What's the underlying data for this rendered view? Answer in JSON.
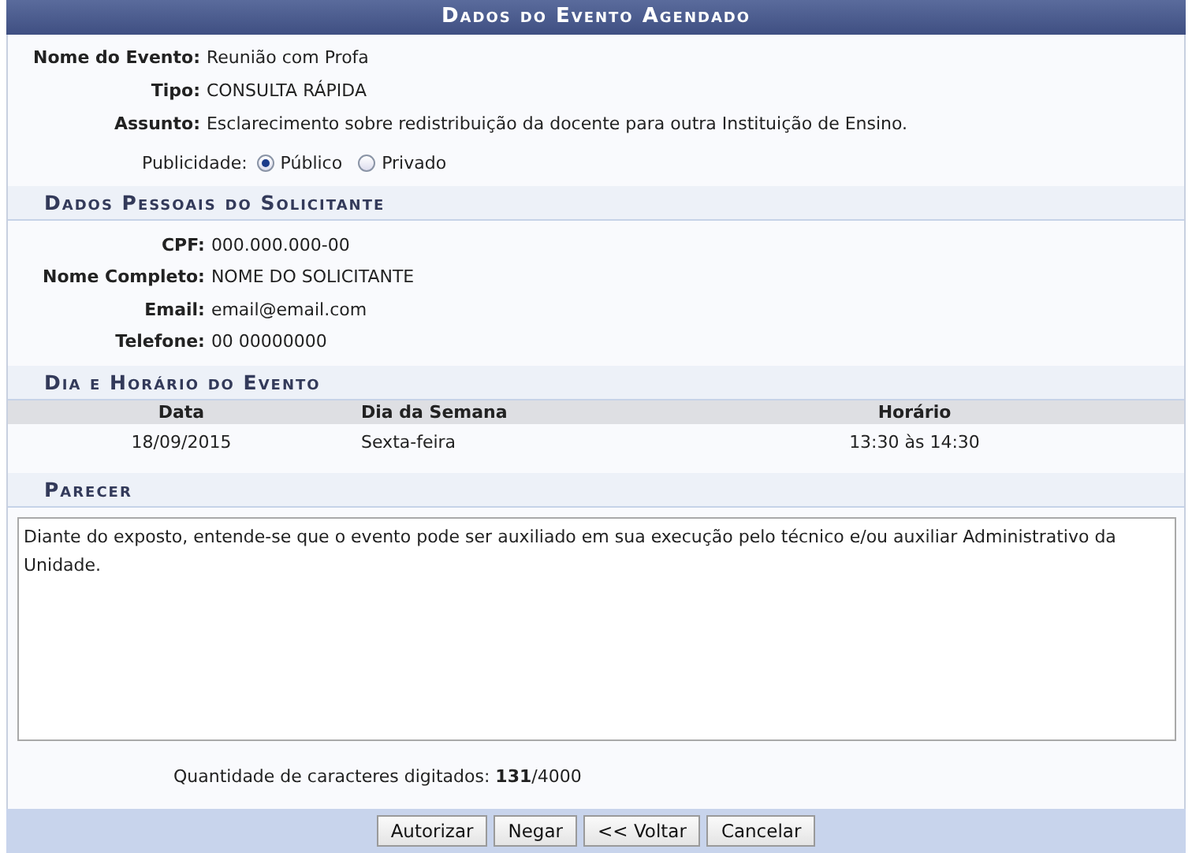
{
  "title": "Dados do Evento Agendado",
  "event_fields": [
    {
      "label": "Nome do Evento:",
      "value": "Reunião com Profa"
    },
    {
      "label": "Tipo:",
      "value": "CONSULTA RÁPIDA"
    },
    {
      "label": "Assunto:",
      "value": "Esclarecimento sobre redistribuição da docente para outra Instituição de Ensino."
    }
  ],
  "publicity": {
    "label": "Publicidade:",
    "options": [
      {
        "label": "Público",
        "selected": true
      },
      {
        "label": "Privado",
        "selected": false
      }
    ]
  },
  "requester": {
    "heading": "Dados Pessoais do Solicitante",
    "fields": [
      {
        "label": "CPF:",
        "value": "000.000.000-00"
      },
      {
        "label": "Nome Completo:",
        "value": "NOME DO SOLICITANTE"
      },
      {
        "label": "Email:",
        "value": "email@email.com"
      },
      {
        "label": "Telefone:",
        "value": "00 00000000"
      }
    ]
  },
  "schedule": {
    "heading": "Dia e Horário do Evento",
    "columns": [
      "Data",
      "Dia da Semana",
      "Horário"
    ],
    "rows": [
      [
        "18/09/2015",
        "Sexta-feira",
        "13:30 às 14:30"
      ]
    ]
  },
  "opinion": {
    "heading": "Parecer",
    "value": "Diante do exposto, entende-se que o evento pode ser auxiliado em sua execução pelo técnico e/ou auxiliar Administrativo da Unidade.",
    "counter": "Quantidade de caracteres digitados: **131**/4000"
  },
  "buttons": [
    "Autorizar",
    "Negar",
    "<< Voltar",
    "Cancelar"
  ]
}
